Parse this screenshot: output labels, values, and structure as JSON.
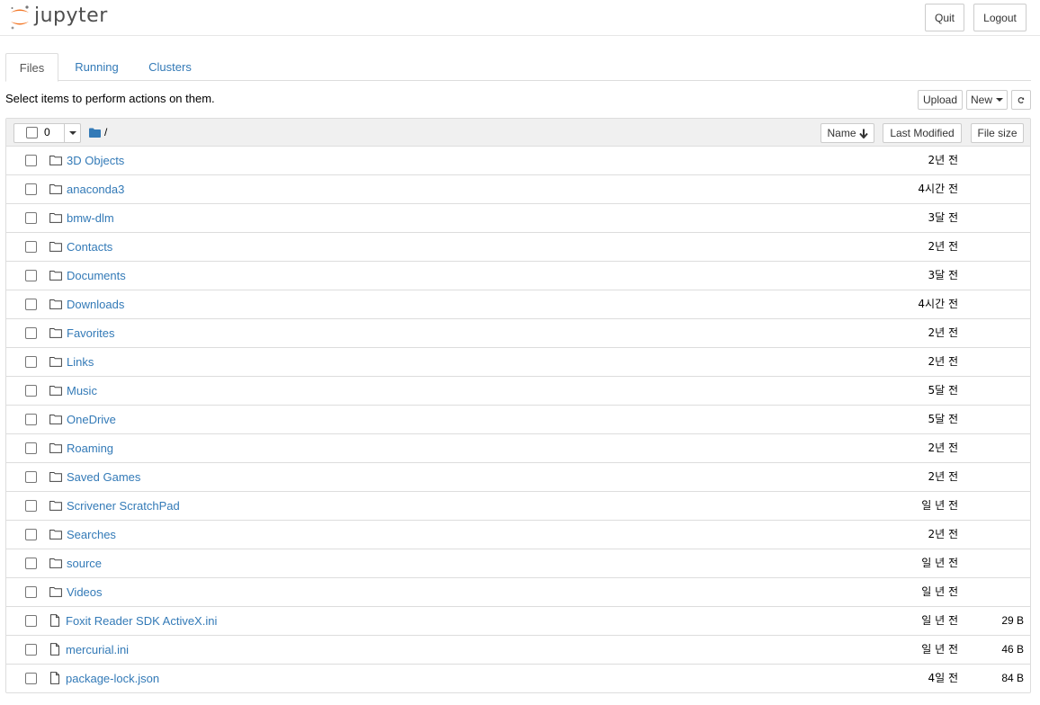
{
  "header": {
    "logo_text": "jupyter",
    "quit_label": "Quit",
    "logout_label": "Logout"
  },
  "tabs": [
    {
      "label": "Files",
      "active": true
    },
    {
      "label": "Running",
      "active": false
    },
    {
      "label": "Clusters",
      "active": false
    }
  ],
  "toolbar": {
    "instructions": "Select items to perform actions on them.",
    "upload_label": "Upload",
    "new_label": "New",
    "refresh_icon": "refresh-icon"
  },
  "list_header": {
    "selected_count": "0",
    "breadcrumb": "/",
    "sort_name_label": "Name",
    "last_modified_label": "Last Modified",
    "file_size_label": "File size"
  },
  "items": [
    {
      "name": "3D Objects",
      "type": "folder",
      "modified": "2년 전",
      "size": ""
    },
    {
      "name": "anaconda3",
      "type": "folder",
      "modified": "4시간 전",
      "size": ""
    },
    {
      "name": "bmw-dlm",
      "type": "folder",
      "modified": "3달 전",
      "size": ""
    },
    {
      "name": "Contacts",
      "type": "folder",
      "modified": "2년 전",
      "size": ""
    },
    {
      "name": "Documents",
      "type": "folder",
      "modified": "3달 전",
      "size": ""
    },
    {
      "name": "Downloads",
      "type": "folder",
      "modified": "4시간 전",
      "size": ""
    },
    {
      "name": "Favorites",
      "type": "folder",
      "modified": "2년 전",
      "size": ""
    },
    {
      "name": "Links",
      "type": "folder",
      "modified": "2년 전",
      "size": ""
    },
    {
      "name": "Music",
      "type": "folder",
      "modified": "5달 전",
      "size": ""
    },
    {
      "name": "OneDrive",
      "type": "folder",
      "modified": "5달 전",
      "size": ""
    },
    {
      "name": "Roaming",
      "type": "folder",
      "modified": "2년 전",
      "size": ""
    },
    {
      "name": "Saved Games",
      "type": "folder",
      "modified": "2년 전",
      "size": ""
    },
    {
      "name": "Scrivener ScratchPad",
      "type": "folder",
      "modified": "일 년 전",
      "size": ""
    },
    {
      "name": "Searches",
      "type": "folder",
      "modified": "2년 전",
      "size": ""
    },
    {
      "name": "source",
      "type": "folder",
      "modified": "일 년 전",
      "size": ""
    },
    {
      "name": "Videos",
      "type": "folder",
      "modified": "일 년 전",
      "size": ""
    },
    {
      "name": "Foxit Reader SDK ActiveX.ini",
      "type": "file",
      "modified": "일 년 전",
      "size": "29 B"
    },
    {
      "name": "mercurial.ini",
      "type": "file",
      "modified": "일 년 전",
      "size": "46 B"
    },
    {
      "name": "package-lock.json",
      "type": "file",
      "modified": "4일 전",
      "size": "84 B"
    }
  ],
  "colors": {
    "link": "#337ab7",
    "logo_orange": "#f37726",
    "header_bg": "#f0f0f0",
    "border": "#dddddd"
  }
}
